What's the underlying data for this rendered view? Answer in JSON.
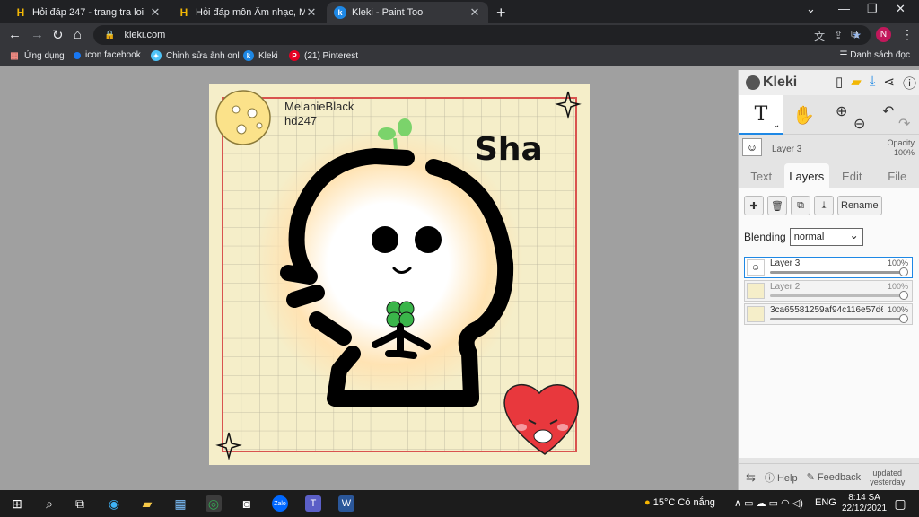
{
  "browser": {
    "tabs": [
      {
        "title": "Hỏi đáp 247 - trang tra loi",
        "favicon": "H"
      },
      {
        "title": "Hỏi đáp môn Âm nhạc, Mỹ thuật",
        "favicon": "H"
      },
      {
        "title": "Kleki - Paint Tool",
        "favicon": "k"
      }
    ],
    "new_tab": "+",
    "url": "kleki.com",
    "profile_initial": "N",
    "bookmarks": [
      {
        "label": "Ứng dụng",
        "icon": "apps-grid-icon"
      },
      {
        "label": "icon facebook",
        "icon": "facebook-icon"
      },
      {
        "label": "Chỉnh sửa ảnh onl",
        "icon": "photo-editor-icon"
      },
      {
        "label": "Kleki",
        "icon": "kleki-icon"
      },
      {
        "label": "(21) Pinterest",
        "icon": "pinterest-icon"
      }
    ],
    "reading_list": "Danh sách đọc"
  },
  "canvas": {
    "text_line1": "MelanieBlack",
    "text_line2": "hd247",
    "big_text": "Sha"
  },
  "kleki": {
    "logo": "Kleki",
    "tool_text": "T",
    "current_layer": {
      "name": "Layer 3",
      "opacity_label": "Opacity",
      "opacity_value": "100%"
    },
    "tabs": [
      "Text",
      "Layers",
      "Edit",
      "File"
    ],
    "active_tab": "Layers",
    "rename_label": "Rename",
    "blending_label": "Blending",
    "blending_value": "normal",
    "layers": [
      {
        "name": "Layer 3",
        "opacity": "100%",
        "selected": true
      },
      {
        "name": "Layer 2",
        "opacity": "100%",
        "selected": false
      },
      {
        "name": "3ca65581259af94c116e57d6",
        "opacity": "100%",
        "selected": false
      }
    ],
    "help_label": "Help",
    "feedback_label": "Feedback",
    "updated_line1": "updated",
    "updated_line2": "yesterday"
  },
  "taskbar": {
    "weather": "15°C  Có nắng",
    "language": "ENG",
    "time": "8:14 SA",
    "date": "22/12/2021"
  },
  "colors": {
    "canvas_bg": "#f5eec9",
    "grid": "#b8b29c",
    "border_red": "#d9534f",
    "accent_blue": "#1e88e5",
    "heart": "#e8383d"
  }
}
